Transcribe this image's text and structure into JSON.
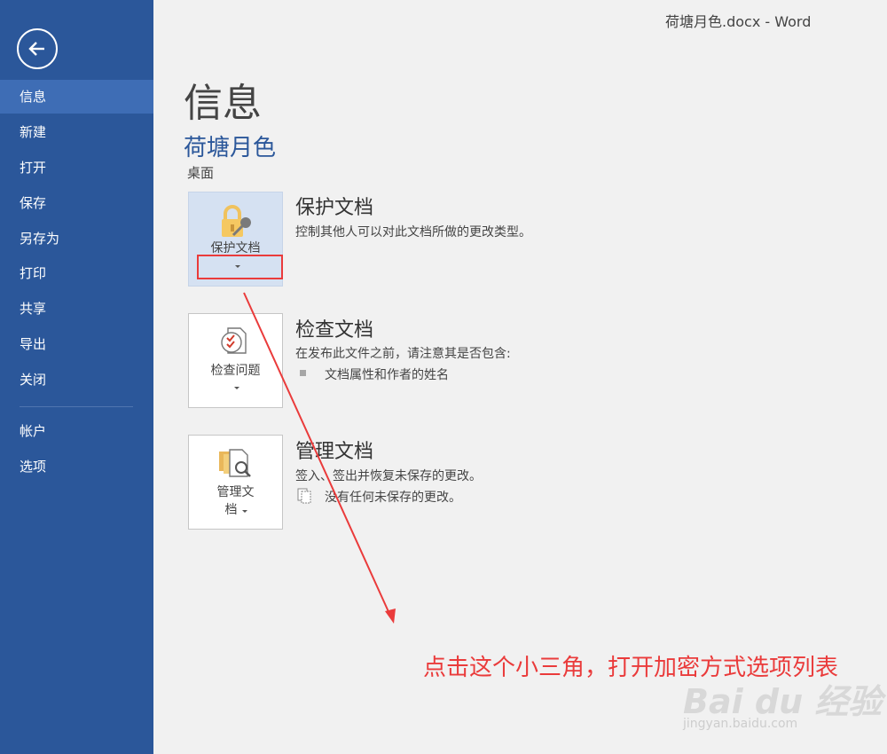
{
  "window": {
    "title": "荷塘月色.docx - Word"
  },
  "sidebar": {
    "items": [
      {
        "label": "信息",
        "active": true
      },
      {
        "label": "新建"
      },
      {
        "label": "打开"
      },
      {
        "label": "保存"
      },
      {
        "label": "另存为"
      },
      {
        "label": "打印"
      },
      {
        "label": "共享"
      },
      {
        "label": "导出"
      },
      {
        "label": "关闭"
      },
      {
        "label": "帐户"
      },
      {
        "label": "选项"
      }
    ]
  },
  "main": {
    "title": "信息",
    "doc_name": "荷塘月色",
    "doc_location": "桌面",
    "protect": {
      "button_label": "保护文档",
      "title": "保护文档",
      "desc": "控制其他人可以对此文档所做的更改类型。"
    },
    "inspect": {
      "button_label": "检查问题",
      "title": "检查文档",
      "desc": "在发布此文件之前，请注意其是否包含:",
      "bullet": "文档属性和作者的姓名"
    },
    "manage": {
      "button_label_1": "管理文",
      "button_label_2": "档",
      "title": "管理文档",
      "desc": "签入、签出并恢复未保存的更改。",
      "status": "没有任何未保存的更改。"
    }
  },
  "annotation": {
    "text": "点击这个小三角，打开加密方式选项列表",
    "color": "#ea3b3b"
  },
  "watermark": {
    "text": "Bai du 经验",
    "sub": "jingyan.baidu.com"
  },
  "colors": {
    "sidebar": "#2b579a",
    "accent": "#2b579a",
    "highlight": "#d5e1f2"
  }
}
